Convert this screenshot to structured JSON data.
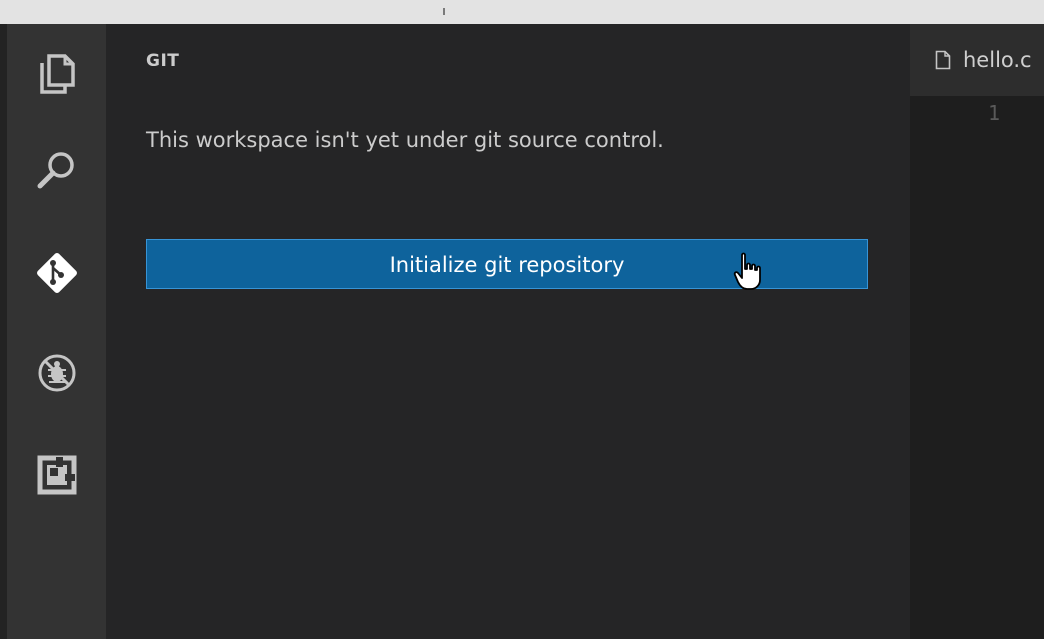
{
  "activity_bar": {
    "items": [
      {
        "name": "explorer",
        "icon": "files-icon"
      },
      {
        "name": "search",
        "icon": "search-icon"
      },
      {
        "name": "git",
        "icon": "git-icon"
      },
      {
        "name": "debug",
        "icon": "debug-icon"
      },
      {
        "name": "extensions",
        "icon": "extensions-icon"
      }
    ],
    "colors": {
      "background": "#333333",
      "icon": "#c5c5c5",
      "active_icon": "#ffffff"
    }
  },
  "sidebar": {
    "title": "GIT",
    "message": "This workspace isn't yet under git source control.",
    "init_button_label": "Initialize git repository"
  },
  "editor": {
    "tab_label": "hello.c",
    "tab_icon": "file-icon",
    "line_numbers": [
      "1"
    ]
  },
  "colors": {
    "accent_button": "#0e639c",
    "button_border": "#3794d6",
    "sidebar_background": "#252526",
    "editor_background": "#1e1e1e"
  },
  "pointer": {
    "icon": "hand-pointer-icon"
  }
}
